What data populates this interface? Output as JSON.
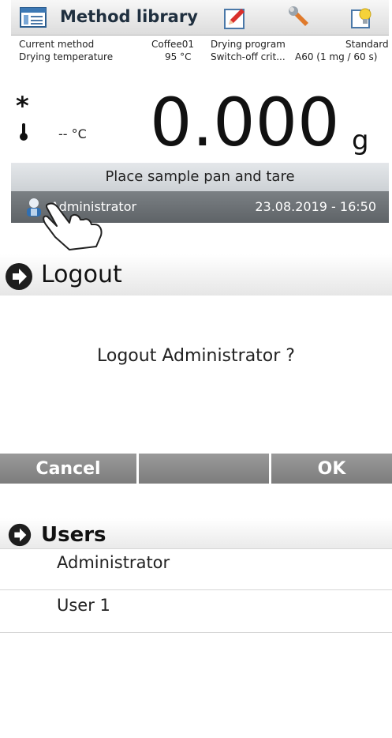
{
  "main_screen": {
    "header": {
      "title": "Method library",
      "icons": [
        "method-library-icon",
        "edit-icon",
        "wrench-icon",
        "tips-icon"
      ]
    },
    "info": {
      "current_method_label": "Current method",
      "current_method_value": "Coffee01",
      "drying_temperature_label": "Drying temperature",
      "drying_temperature_value": "95 °C",
      "drying_program_label": "Drying program",
      "drying_program_value": "Standard",
      "switch_off_label": "Switch-off crit...",
      "switch_off_value": "A60  (1 mg / 60 s)"
    },
    "weight": {
      "value": "0.000",
      "unit": "g"
    },
    "stability_symbol": "*",
    "temperature_readout": "-- °C",
    "prompt": "Place sample pan and tare",
    "status_bar": {
      "user": "Administrator",
      "datetime": "23.08.2019 - 16:50"
    }
  },
  "logout_dialog": {
    "title": "Logout",
    "message": "Logout Administrator ?",
    "buttons": {
      "cancel": "Cancel",
      "ok": "OK"
    }
  },
  "users_dialog": {
    "title": "Users",
    "users": [
      "Administrator",
      "User 1"
    ]
  },
  "colors": {
    "status_bar": "#6a6f73",
    "prompt_bar": "#d8dce0",
    "button": "#8a8a8a",
    "arrow_circle": "#1e1e1e"
  }
}
